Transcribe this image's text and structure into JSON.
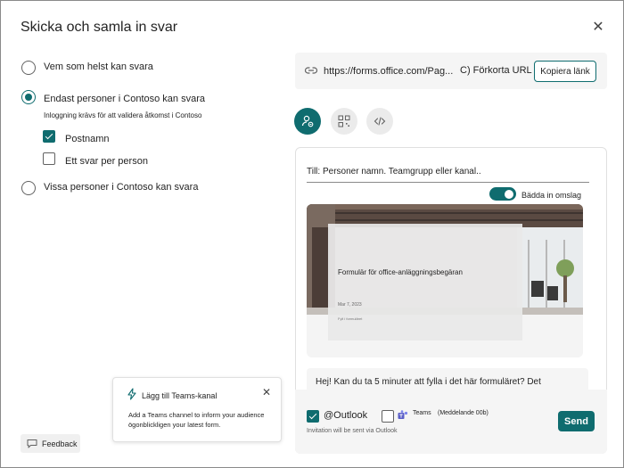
{
  "dialog": {
    "title": "Skicka och samla in svar",
    "close_icon": "close-icon"
  },
  "audience": {
    "options": [
      {
        "label": "Vem som helst kan svara",
        "selected": false
      },
      {
        "label": "Endast personer i Contoso kan svara",
        "selected": true
      },
      {
        "label": "Vissa personer i Contoso kan svara",
        "selected": false
      }
    ],
    "note": "Inloggning krävs för att validera åtkomst i Contoso",
    "checkboxes": [
      {
        "label": "Postnamn",
        "checked": true
      },
      {
        "label": "Ett svar per person",
        "checked": false
      }
    ]
  },
  "link": {
    "url": "https://forms.office.com/Pag...",
    "shorten_label": "C) Förkorta URL",
    "copy_label": "Kopiera länk"
  },
  "modes": [
    "send-email-icon",
    "qr-code-icon",
    "embed-code-icon"
  ],
  "compose": {
    "to_label": "Till: Personer namn. Teamgrupp eller kanal..",
    "embed_toggle_label": "Bädda in omslag",
    "embed_toggle_on": true,
    "card_title": "Formulär för office-anläggningsbegäran",
    "card_date": "Mar 7, 2023",
    "card_small": "Fyll i formuläret",
    "message": "Hej! Kan du ta 5 minuter att fylla i det här formuläret? Det",
    "outlook_label": "@Outlook",
    "outlook_checked": true,
    "teams_label": "Teams",
    "teams_meta": "(Meddelande 00b)",
    "teams_checked": false,
    "invite_note": "Invitation will be sent via Outlook",
    "send_label": "Send"
  },
  "teams_card": {
    "title": "Lägg till Teams-kanal",
    "body": "Add a Teams channel to inform your audience ögonblickligen your latest form."
  },
  "feedback_label": "Feedback",
  "colors": {
    "accent": "#0f6c6f",
    "panel_bg": "#f5f5f5"
  }
}
